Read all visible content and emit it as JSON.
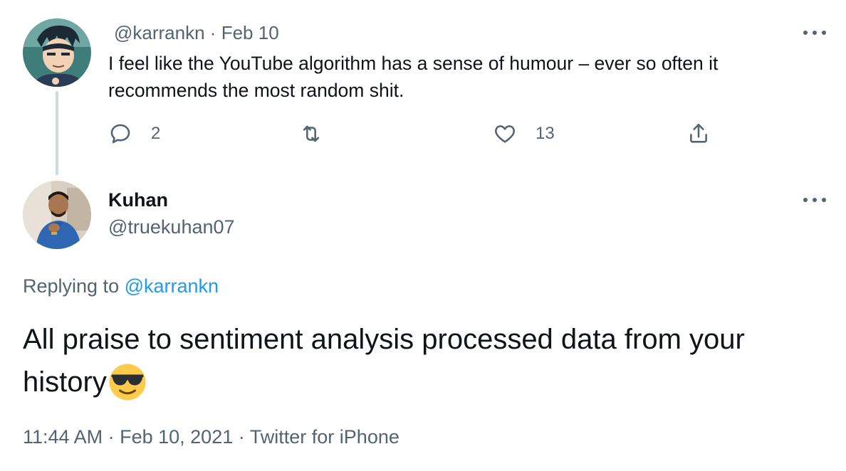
{
  "parent_tweet": {
    "handle": "@karrankn",
    "separator": "·",
    "date": "Feb 10",
    "text": "I feel like the YouTube algorithm has a sense of humour – ever so often it recommends the most random shit.",
    "reply_count": "2",
    "retweet_count": "",
    "like_count": "13",
    "icons": [
      "reply-icon",
      "retweet-icon",
      "like-icon",
      "share-icon",
      "more-icon"
    ]
  },
  "reply_tweet": {
    "display_name": "Kuhan",
    "handle": "@truekuhan07",
    "replying_prefix": "Replying to",
    "replying_to": "@karrankn",
    "text": "All praise to sentiment analysis processed data from your history",
    "emoji": "smiling-face-with-sunglasses",
    "time": "11:44 AM",
    "full_date": "Feb 10, 2021",
    "source": "Twitter for iPhone",
    "separator": "·"
  },
  "colors": {
    "text_primary": "#0f1419",
    "text_secondary": "#536471",
    "link": "#1d9bf0",
    "thread_line": "#cfd9de"
  }
}
